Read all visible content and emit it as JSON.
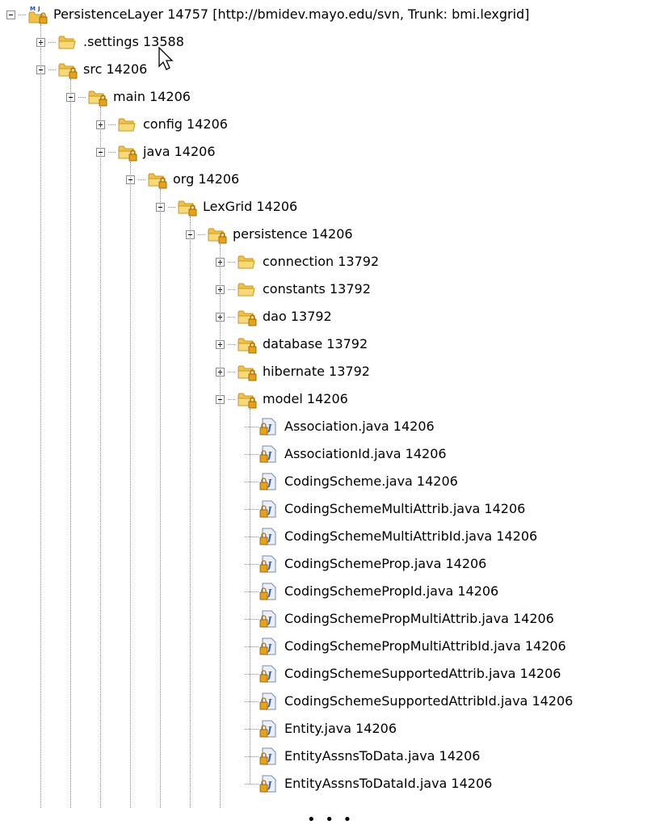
{
  "tree": {
    "nodes": [
      {
        "label": "PersistenceLayer 14757 [http://bmidev.mayo.edu/svn, Trunk: bmi.lexgrid]",
        "icon": "project-icon",
        "toggle": "minus",
        "depth": 0
      },
      {
        "label": ".settings 13588",
        "icon": "folder-icon",
        "toggle": "plus",
        "depth": 1
      },
      {
        "label": "src 14206",
        "icon": "package-folder-icon",
        "toggle": "minus",
        "depth": 1
      },
      {
        "label": "main 14206",
        "icon": "package-folder-icon",
        "toggle": "minus",
        "depth": 2
      },
      {
        "label": "config 14206",
        "icon": "folder-icon",
        "toggle": "plus",
        "depth": 3
      },
      {
        "label": "java 14206",
        "icon": "package-folder-icon",
        "toggle": "minus",
        "depth": 3
      },
      {
        "label": "org 14206",
        "icon": "package-folder-icon",
        "toggle": "minus",
        "depth": 4
      },
      {
        "label": "LexGrid 14206",
        "icon": "package-folder-icon",
        "toggle": "minus",
        "depth": 5
      },
      {
        "label": "persistence 14206",
        "icon": "package-folder-icon",
        "toggle": "minus",
        "depth": 6
      },
      {
        "label": "connection 13792",
        "icon": "folder-icon",
        "toggle": "plus",
        "depth": 7
      },
      {
        "label": "constants 13792",
        "icon": "folder-icon",
        "toggle": "plus",
        "depth": 7
      },
      {
        "label": "dao 13792",
        "icon": "package-folder-icon",
        "toggle": "plus",
        "depth": 7
      },
      {
        "label": "database 13792",
        "icon": "package-folder-icon",
        "toggle": "plus",
        "depth": 7
      },
      {
        "label": "hibernate 13792",
        "icon": "package-folder-icon",
        "toggle": "plus",
        "depth": 7
      },
      {
        "label": "model 14206",
        "icon": "package-folder-icon",
        "toggle": "minus",
        "depth": 7
      },
      {
        "label": "Association.java 14206",
        "icon": "java-file-icon",
        "toggle": "none",
        "depth": 8
      },
      {
        "label": "AssociationId.java 14206",
        "icon": "java-file-icon",
        "toggle": "none",
        "depth": 8
      },
      {
        "label": "CodingScheme.java 14206",
        "icon": "java-file-icon",
        "toggle": "none",
        "depth": 8
      },
      {
        "label": "CodingSchemeMultiAttrib.java 14206",
        "icon": "java-file-icon",
        "toggle": "none",
        "depth": 8
      },
      {
        "label": "CodingSchemeMultiAttribId.java 14206",
        "icon": "java-file-icon",
        "toggle": "none",
        "depth": 8
      },
      {
        "label": "CodingSchemeProp.java 14206",
        "icon": "java-file-icon",
        "toggle": "none",
        "depth": 8
      },
      {
        "label": "CodingSchemePropId.java 14206",
        "icon": "java-file-icon",
        "toggle": "none",
        "depth": 8
      },
      {
        "label": "CodingSchemePropMultiAttrib.java 14206",
        "icon": "java-file-icon",
        "toggle": "none",
        "depth": 8
      },
      {
        "label": "CodingSchemePropMultiAttribId.java 14206",
        "icon": "java-file-icon",
        "toggle": "none",
        "depth": 8
      },
      {
        "label": "CodingSchemeSupportedAttrib.java 14206",
        "icon": "java-file-icon",
        "toggle": "none",
        "depth": 8
      },
      {
        "label": "CodingSchemeSupportedAttribId.java 14206",
        "icon": "java-file-icon",
        "toggle": "none",
        "depth": 8
      },
      {
        "label": "Entity.java 14206",
        "icon": "java-file-icon",
        "toggle": "none",
        "depth": 8
      },
      {
        "label": "EntityAssnsToData.java 14206",
        "icon": "java-file-icon",
        "toggle": "none",
        "depth": 8
      },
      {
        "label": "EntityAssnsToDataId.java 14206",
        "icon": "java-file-icon",
        "toggle": "none",
        "depth": 8
      }
    ],
    "more_indicator": "• • •"
  },
  "colors": {
    "folder": "#f0c24a",
    "folder_dark": "#c8961e",
    "java_doc": "#e9eef7",
    "java_letter": "#3060b8",
    "lock_overlay": "#e6a21a",
    "connector": "#8a8a8a"
  }
}
